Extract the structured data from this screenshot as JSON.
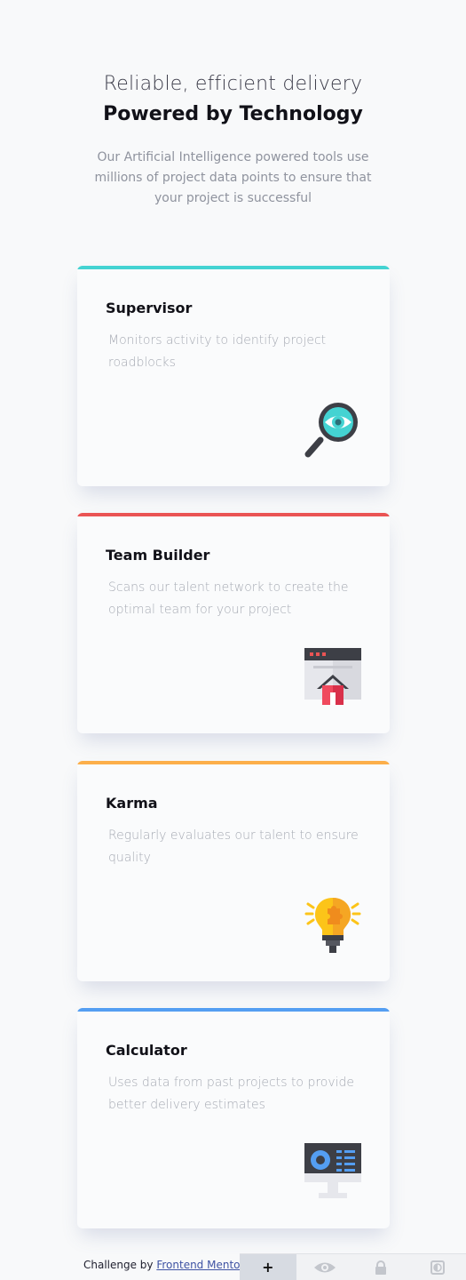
{
  "header": {
    "subtitle": "Reliable, efficient delivery",
    "title": "Powered by Technology",
    "description": "Our Artificial Intelligence powered tools use millions of project data points to ensure that your project is successful"
  },
  "cards": [
    {
      "title": "Supervisor",
      "description": "Monitors activity to identify project roadblocks",
      "accent": "#44d3d2",
      "icon": "magnifier-eye-icon"
    },
    {
      "title": "Team Builder",
      "description": "Scans our talent network to create the optimal team for your project",
      "accent": "#ea5454",
      "icon": "browser-house-icon"
    },
    {
      "title": "Karma",
      "description": "Regularly evaluates our talent to ensure quality",
      "accent": "#fcaf4a",
      "icon": "lightbulb-puzzle-icon"
    },
    {
      "title": "Calculator",
      "description": "Uses data from past projects to provide better delivery estimates",
      "accent": "#549ef2",
      "icon": "monitor-chart-icon"
    }
  ],
  "footer": {
    "attribution_prefix": "Challenge by ",
    "attribution_link": "Frontend Mentor",
    "toolbar": [
      {
        "icon": "plus-icon",
        "label": "+"
      },
      {
        "icon": "eye-icon"
      },
      {
        "icon": "lock-icon"
      },
      {
        "icon": "contrast-icon"
      }
    ]
  }
}
